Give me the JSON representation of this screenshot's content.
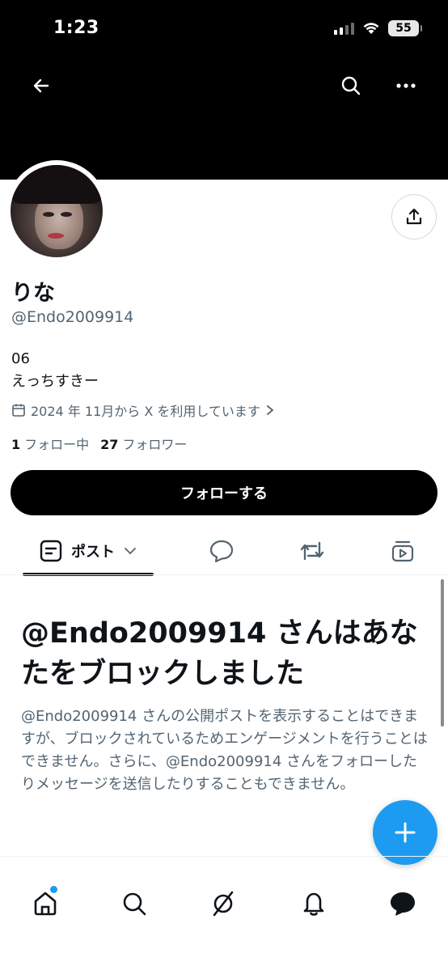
{
  "status_bar": {
    "time": "1:23",
    "battery": "55"
  },
  "header": {
    "back_icon": "arrow-left-icon",
    "search_icon": "search-icon",
    "more_icon": "more-horizontal-icon"
  },
  "profile": {
    "display_name": "りな",
    "handle": "@Endo2009914",
    "bio_line1": "06",
    "bio_line2": "えっちすきー",
    "joined": "2024 年 11月から X を利用しています",
    "following_count": "1",
    "following_label": "フォロー中",
    "followers_count": "27",
    "followers_label": "フォロワー",
    "follow_button": "フォローする"
  },
  "tabs": {
    "posts_label": "ポスト",
    "items": [
      "posts",
      "replies",
      "reposts",
      "media"
    ]
  },
  "blocked": {
    "title": "@Endo2009914 さんはあなたをブロックしました",
    "description": "@Endo2009914 さんの公開ポストを表示することはできますが、ブロックされているためエンゲージメントを行うことはできません。さらに、@Endo2009914 さんをフォローしたりメッセージを送信したりすることもできません。"
  },
  "bottom_nav": [
    "home-icon",
    "search-icon",
    "grok-icon",
    "bell-icon",
    "messages-icon"
  ],
  "colors": {
    "accent": "#1d9bf0",
    "text": "#0f1419",
    "muted": "#536471"
  }
}
